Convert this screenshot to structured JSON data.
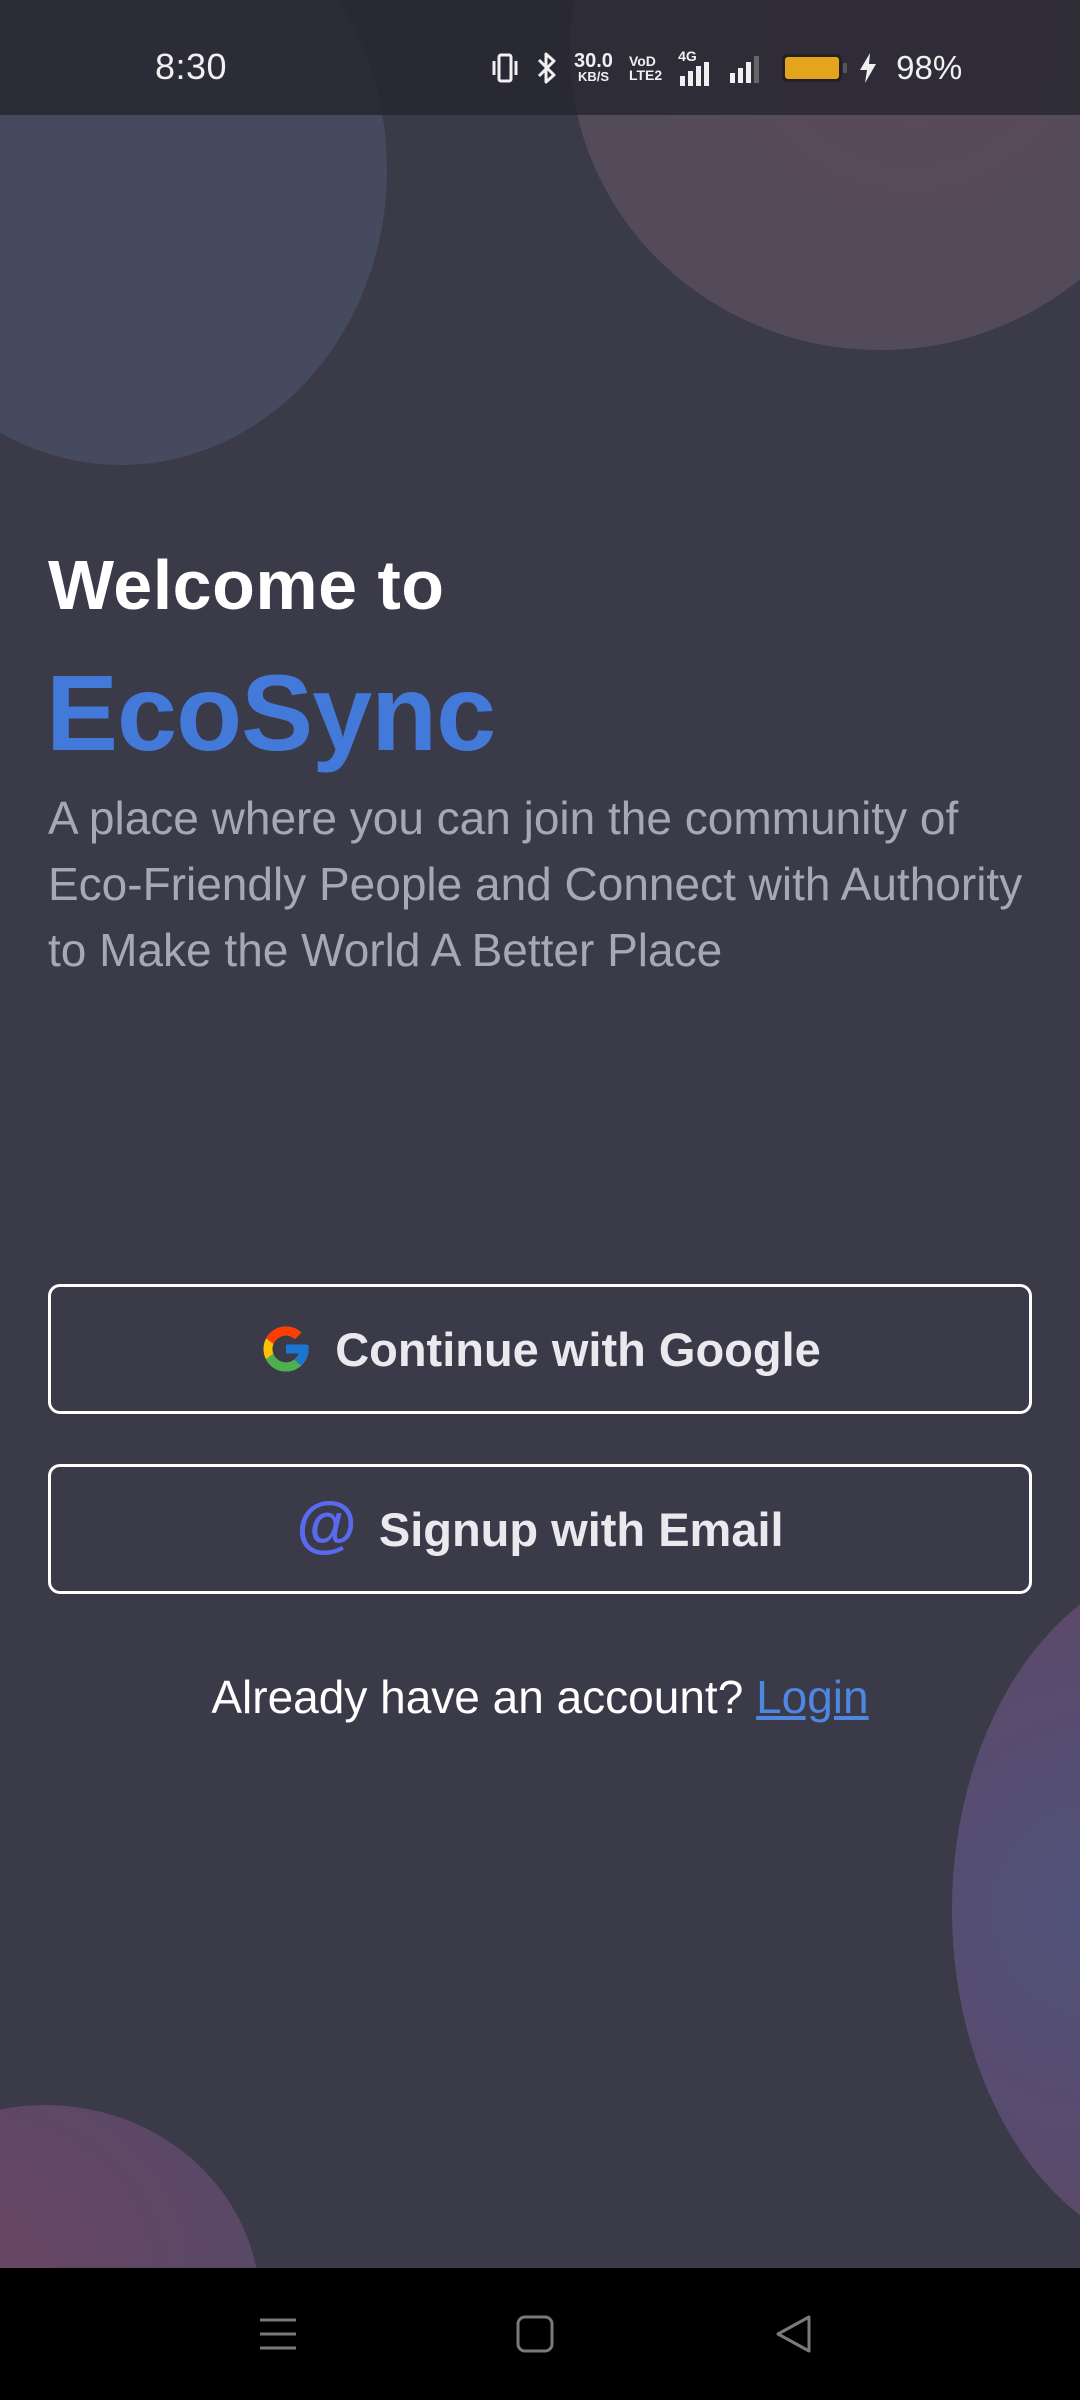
{
  "status_bar": {
    "time": "8:30",
    "net_speed_value": "30.0",
    "net_speed_unit": "KB/S",
    "volte_top": "VoD",
    "volte_bottom": "LTE2",
    "network_type": "4G",
    "battery_percent": "98%",
    "battery_level": 0.98,
    "battery_color": "#e2a51c",
    "icons": [
      "vibrate-icon",
      "bluetooth-icon",
      "signal-icon",
      "signal-icon",
      "battery-icon",
      "charging-bolt-icon"
    ]
  },
  "hero": {
    "welcome": "Welcome to",
    "brand": "EcoSync",
    "tagline": "A place where you can join the community of Eco-Friendly People and Connect with Authority to Make the World A Better Place"
  },
  "actions": {
    "google_label": "Continue with Google",
    "email_label": "Signup with Email",
    "email_icon_glyph": "@"
  },
  "login_prompt": {
    "text": "Already have an account?",
    "link": "Login"
  },
  "nav_bar": {
    "buttons": [
      "menu-icon",
      "home-square-icon",
      "back-triangle-icon"
    ]
  },
  "colors": {
    "background": "#3a3a49",
    "brand_accent": "#4379d8",
    "link": "#4f86e0",
    "email_icon": "#5a6aee"
  }
}
